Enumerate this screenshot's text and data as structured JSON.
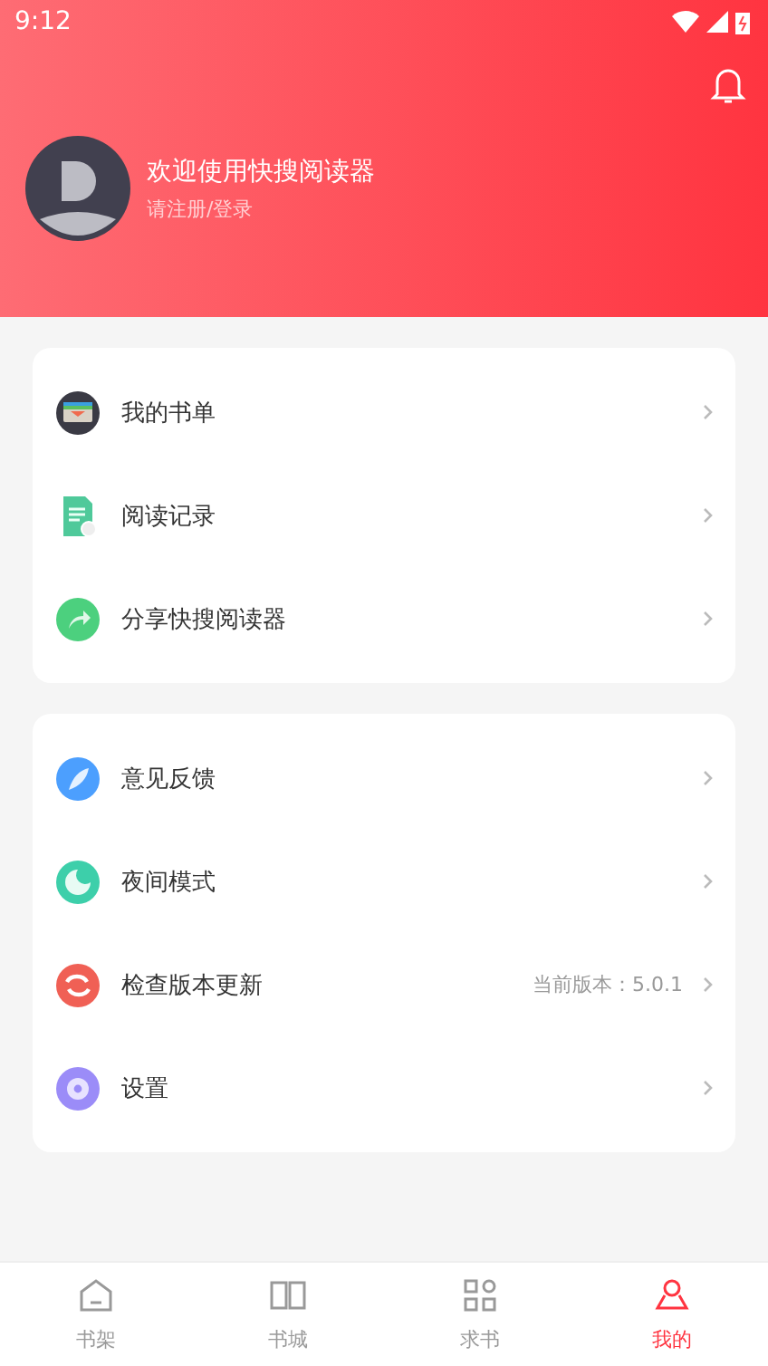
{
  "status_bar": {
    "time": "9:12"
  },
  "profile": {
    "title": "欢迎使用快搜阅读器",
    "subtitle": "请注册/登录"
  },
  "menu_groups": [
    {
      "items": [
        {
          "kind": "booklist",
          "label": "我的书单"
        },
        {
          "kind": "history",
          "label": "阅读记录"
        },
        {
          "kind": "share",
          "label": "分享快搜阅读器"
        }
      ]
    },
    {
      "items": [
        {
          "kind": "feedback",
          "label": "意见反馈"
        },
        {
          "kind": "night",
          "label": "夜间模式"
        },
        {
          "kind": "update",
          "label": "检查版本更新",
          "value": "当前版本：5.0.1"
        },
        {
          "kind": "settings",
          "label": "设置"
        }
      ]
    }
  ],
  "tab_bar": [
    {
      "kind": "shelf",
      "label": "书架",
      "selected": false
    },
    {
      "kind": "store",
      "label": "书城",
      "selected": false
    },
    {
      "kind": "request",
      "label": "求书",
      "selected": false
    },
    {
      "kind": "mine",
      "label": "我的",
      "selected": true
    }
  ]
}
